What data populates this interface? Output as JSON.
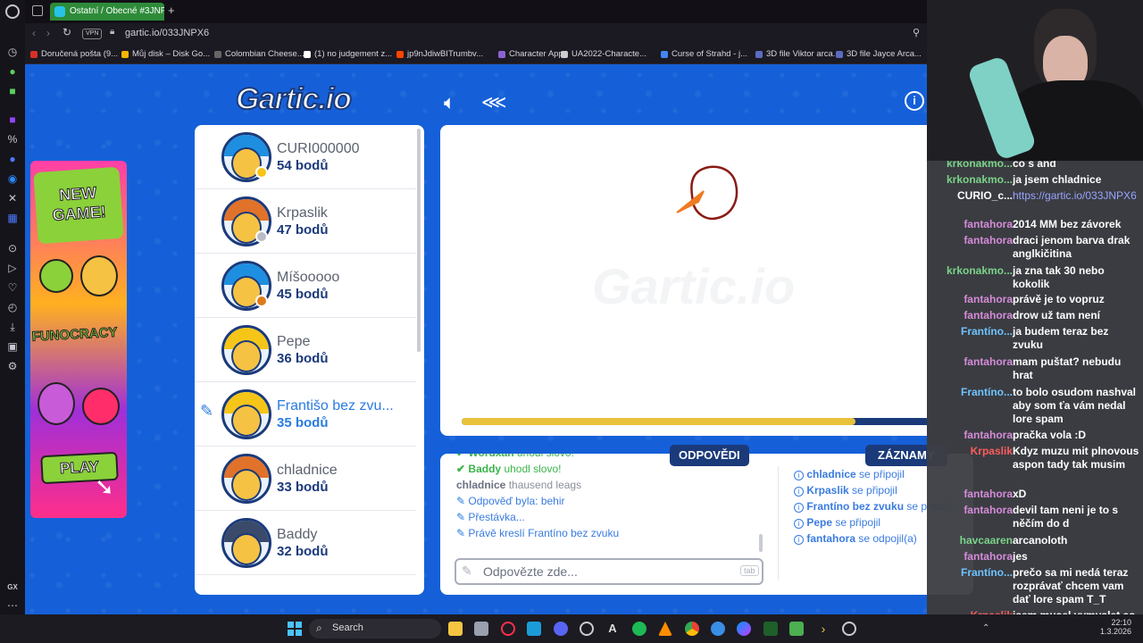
{
  "browser": {
    "tab_title": "Ostatní / Obecné #3JNPX6",
    "vpn_label": "VPN",
    "url": "gartic.io/033JNPX6",
    "bookmarks": [
      {
        "label": "Doručená pošta (9...",
        "color": "#d93025"
      },
      {
        "label": "Můj disk – Disk Go...",
        "color": "#f4b400"
      },
      {
        "label": "Colombian Cheese...",
        "color": "#666666"
      },
      {
        "label": "(1) no judgement z...",
        "color": "#ffffff"
      },
      {
        "label": "jp9nJdiwBITrumbv...",
        "color": "#ff4500"
      },
      {
        "label": "Character App",
        "color": "#8a63d2"
      },
      {
        "label": "UA2022-Characte...",
        "color": "#cccccc"
      },
      {
        "label": "Curse of Strahd - j...",
        "color": "#4285f4"
      },
      {
        "label": "3D file Viktor arca...",
        "color": "#5c6bc0"
      },
      {
        "label": "3D file Jayce Arca...",
        "color": "#5c6bc0"
      }
    ]
  },
  "game": {
    "logo": "Gartic.io",
    "watermark": "Gartic.io",
    "ad": {
      "new_game": "NEW GAME!",
      "funocracy": "FUNOCRACY",
      "play": "PLAY"
    },
    "players": [
      {
        "name": "CURI000000",
        "points": "54 bodů",
        "hair": "#1e8fe0",
        "dot": "#f5c518"
      },
      {
        "name": "Krpaslik",
        "points": "47 bodů",
        "hair": "#e0722a",
        "dot": "#b9bcc4"
      },
      {
        "name": "Míšooooo",
        "points": "45 bodů",
        "hair": "#1e8fe0",
        "dot": "#e07a17"
      },
      {
        "name": "Pepe",
        "points": "36 bodů",
        "hair": "#f5c518",
        "dot": ""
      },
      {
        "name": "Františo bez zvu...",
        "points": "35 bodů",
        "hair": "#f5c518",
        "dot": ""
      },
      {
        "name": "chladnice",
        "points": "33 bodů",
        "hair": "#e0722a",
        "dot": ""
      },
      {
        "name": "Baddy",
        "points": "32 bodů",
        "hair": "#3a4a6a",
        "dot": ""
      }
    ],
    "tabs": {
      "answers": "ODPOVĚDI",
      "records": "ZÁZNAMY"
    },
    "progress": 0.84,
    "answers": [
      {
        "user": "Woruxan",
        "text": "uhodl slovo!",
        "kind": "guess"
      },
      {
        "user": "Baddy",
        "text": "uhodl slovo!",
        "kind": "guess"
      },
      {
        "user": "chladnice",
        "text": "thausend leags",
        "kind": "plain"
      },
      {
        "user": "",
        "text": "Odpověď byla: behir",
        "kind": "info"
      },
      {
        "user": "",
        "text": "Přestávka...",
        "kind": "info"
      },
      {
        "user": "",
        "text": "Právě kreslí Frantíno bez zvuku",
        "kind": "info"
      }
    ],
    "answer_placeholder": "Odpovězte zde...",
    "tab_hint": "tab",
    "records": [
      {
        "user": "chladnice",
        "text": "se připojil"
      },
      {
        "user": "Krpaslik",
        "text": "se připojil"
      },
      {
        "user": "Frantíno bez zvuku",
        "text": "se připojil"
      },
      {
        "user": "Pepe",
        "text": "se připojil"
      },
      {
        "user": "fantahora",
        "text": "se odpojil(a)"
      }
    ]
  },
  "chat": [
    {
      "user": "krkonakmo...",
      "text": "čo s ând",
      "color": "#7bd389"
    },
    {
      "user": "krkonakmo...",
      "text": "ja jsem chladnice",
      "color": "#7bd389"
    },
    {
      "user": "CURIO_c...",
      "text": "https://gartic.io/033JNPX6",
      "color": "#ffffff"
    },
    {
      "user": "fantahora",
      "text": "2014 MM bez závorek",
      "color": "#d58bd9"
    },
    {
      "user": "fantahora",
      "text": "draci jenom barva drak anglkičitina",
      "color": "#d58bd9"
    },
    {
      "user": "krkonakmo...",
      "text": "ja zna tak 30 nebo kokolik",
      "color": "#7bd389"
    },
    {
      "user": "fantahora",
      "text": "právě je to vopruz",
      "color": "#d58bd9"
    },
    {
      "user": "fantahora",
      "text": "drow už tam není",
      "color": "#d58bd9"
    },
    {
      "user": "Frantíno...",
      "text": "ja budem teraz bez zvuku",
      "color": "#6fc3ff"
    },
    {
      "user": "fantahora",
      "text": "mam puštat? nebudu hrat",
      "color": "#d58bd9"
    },
    {
      "user": "Frantíno...",
      "text": "to bolo osudom nashval aby som ťa vám nedal lore spam",
      "color": "#6fc3ff"
    },
    {
      "user": "fantahora",
      "text": "pračka vola :D",
      "color": "#d58bd9"
    },
    {
      "user": "Krpaslik",
      "text": "Kdyz muzu mit plnovous aspon tady tak musim",
      "color": "#ff5c5c"
    },
    {
      "user": "fantahora",
      "text": "xD",
      "color": "#d58bd9"
    },
    {
      "user": "fantahora",
      "text": "devil tam neni je to s něčím do d",
      "color": "#d58bd9"
    },
    {
      "user": "havcaaren",
      "text": "arcanoloth",
      "color": "#7bd389"
    },
    {
      "user": "fantahora",
      "text": "jes",
      "color": "#d58bd9"
    },
    {
      "user": "Frantíno...",
      "text": "prečo sa mi nedá teraz rozprávať chcem vam dať lore spam T_T",
      "color": "#6fc3ff"
    },
    {
      "user": "Krpaslik",
      "text": "jsem musel vymyslet co všechno je za kovy",
      "color": "#ff5c5c"
    }
  ],
  "taskbar": {
    "search": "Search",
    "time": "22:10",
    "date": "1.3.2026"
  }
}
